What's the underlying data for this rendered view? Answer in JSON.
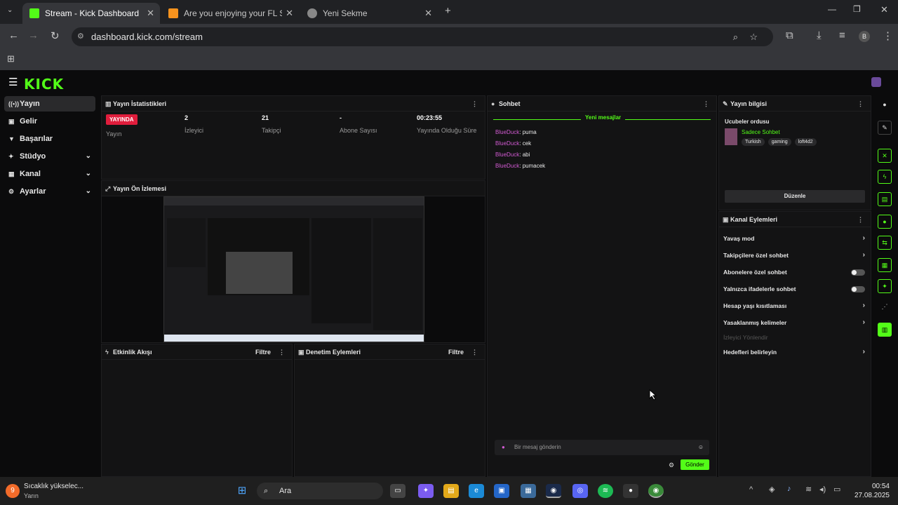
{
  "browser": {
    "tabs": [
      {
        "label": "Stream - Kick Dashboard",
        "active": true
      },
      {
        "label": "Are you enjoying your FL Studio",
        "active": false
      },
      {
        "label": "Yeni Sekme",
        "active": false
      }
    ],
    "url": "dashboard.kick.com/stream",
    "profile_initial": "B"
  },
  "app": {
    "logo": "KICK",
    "sidebar": [
      {
        "label": "Yayın",
        "icon": "broadcast-icon",
        "expandable": false,
        "active": true
      },
      {
        "label": "Gelir",
        "icon": "wallet-icon",
        "expandable": false,
        "active": false
      },
      {
        "label": "Başarılar",
        "icon": "trophy-icon",
        "expandable": false,
        "active": false
      },
      {
        "label": "Stüdyo",
        "icon": "studio-icon",
        "expandable": true,
        "active": false
      },
      {
        "label": "Kanal",
        "icon": "channel-icon",
        "expandable": true,
        "active": false
      },
      {
        "label": "Ayarlar",
        "icon": "gear-icon",
        "expandable": true,
        "active": false
      }
    ],
    "stats": {
      "title": "Yayın İstatistikleri",
      "live_badge": "YAYINDA",
      "live_label": "Yayın",
      "items": [
        {
          "value": "2",
          "label": "İzleyici"
        },
        {
          "value": "21",
          "label": "Takipçi"
        },
        {
          "value": "-",
          "label": "Abone Sayısı"
        },
        {
          "value": "00:23:55",
          "label": "Yayında Olduğu Süre"
        }
      ]
    },
    "preview": {
      "title": "Yayın Ön İzlemesi"
    },
    "activity": {
      "title": "Etkinlik Akışı",
      "filter": "Filtre"
    },
    "moderation": {
      "title": "Denetim Eylemleri",
      "filter": "Filtre"
    },
    "chat": {
      "title": "Sohbet",
      "new_messages": "Yeni mesajlar",
      "messages": [
        {
          "user": "BlueDuck",
          "text": "puma"
        },
        {
          "user": "BlueDuck",
          "text": "cek"
        },
        {
          "user": "BlueDuck",
          "text": "abi"
        },
        {
          "user": "BlueDuck",
          "text": "pumacek"
        }
      ],
      "input_placeholder": "Bir mesaj gönderin",
      "send": "Gönder"
    },
    "stream_info": {
      "title": "Yayın bilgisi",
      "stream_title": "Ucubeler ordusu",
      "category": "Sadece Sohbet",
      "tags": [
        "Turkish",
        "gaming",
        "loft4d2"
      ],
      "edit": "Düzenle"
    },
    "channel_actions": {
      "title": "Kanal Eylemleri",
      "items": [
        {
          "label": "Yavaş mod",
          "type": "arrow",
          "disabled": false
        },
        {
          "label": "Takipçilere özel sohbet",
          "type": "arrow",
          "disabled": false
        },
        {
          "label": "Abonelere özel sohbet",
          "type": "toggle",
          "disabled": false
        },
        {
          "label": "Yalnızca ifadelerle sohbet",
          "type": "toggle",
          "disabled": false
        },
        {
          "label": "Hesap yaşı kısıtlaması",
          "type": "arrow",
          "disabled": false
        },
        {
          "label": "Yasaklanmış kelimeler",
          "type": "arrow",
          "disabled": false
        },
        {
          "label": "İzleyici Yönlendir",
          "type": "none",
          "disabled": true
        },
        {
          "label": "Hedefleri belirleyin",
          "type": "arrow",
          "disabled": false
        }
      ]
    }
  },
  "taskbar": {
    "weather_title": "Sıcaklık yükselec...",
    "weather_sub": "Yarın",
    "search": "Ara",
    "time": "00:54",
    "date": "27.08.2025"
  },
  "colors": {
    "brand": "#53fc18",
    "live": "#e01d3c",
    "username": "#d25bd3"
  }
}
